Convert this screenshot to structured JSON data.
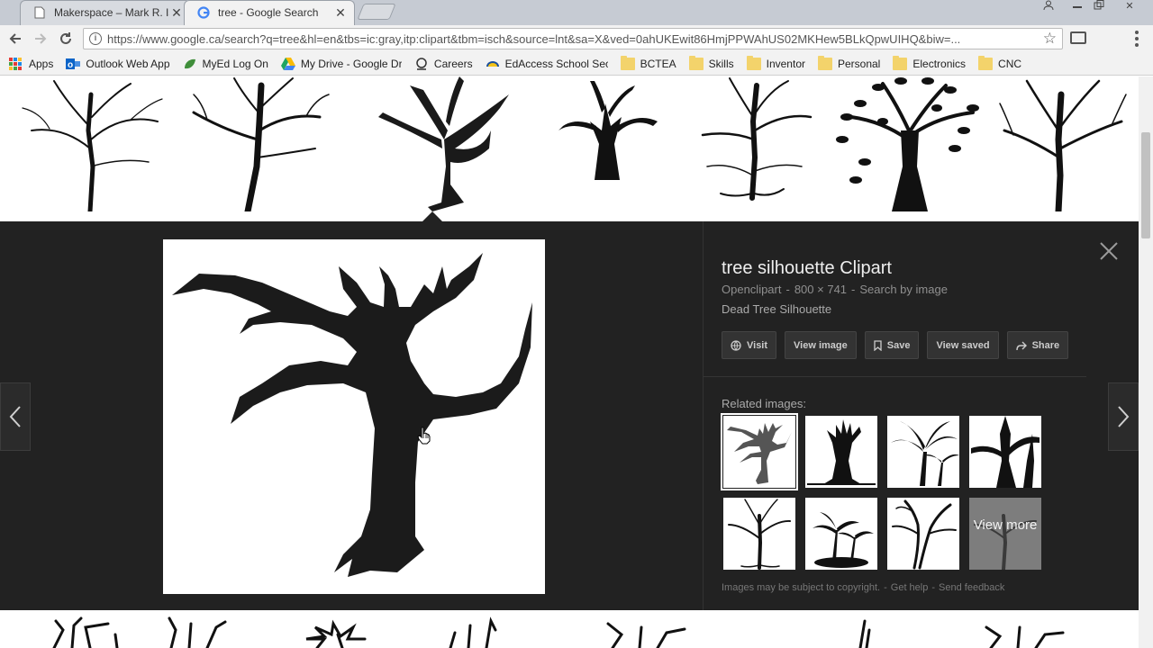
{
  "browser": {
    "tabs": [
      {
        "title": "Makerspace – Mark R. Isf",
        "active": false
      },
      {
        "title": "tree - Google Search",
        "active": true
      }
    ],
    "url": "https://www.google.ca/search?q=tree&hl=en&tbs=ic:gray,itp:clipart&tbm=isch&source=lnt&sa=X&ved=0ahUKEwit86HmjPPWAhUS02MKHew5BLkQpwUIHQ&biw=...",
    "bookmarks": [
      {
        "label": "Apps",
        "icon": "apps-grid-icon"
      },
      {
        "label": "Outlook Web App",
        "icon": "outlook-icon"
      },
      {
        "label": "MyEd Log On",
        "icon": "myed-icon"
      },
      {
        "label": "My Drive - Google Dr",
        "icon": "google-drive-icon"
      },
      {
        "label": "Careers",
        "icon": "careers-icon"
      },
      {
        "label": "EdAccess School Sec",
        "icon": "edaccess-icon"
      },
      {
        "label": "BCTEA",
        "icon": "folder-icon"
      },
      {
        "label": "Skills",
        "icon": "folder-icon"
      },
      {
        "label": "Inventor",
        "icon": "folder-icon"
      },
      {
        "label": "Personal",
        "icon": "folder-icon"
      },
      {
        "label": "Electronics",
        "icon": "folder-icon"
      },
      {
        "label": "CNC",
        "icon": "folder-icon"
      }
    ]
  },
  "viewer": {
    "title": "tree silhouette Clipart",
    "source": "Openclipart",
    "dimensions": "800 × 741",
    "search_by_image": "Search by image",
    "description": "Dead Tree Silhouette",
    "actions": {
      "visit": "Visit",
      "view_image": "View image",
      "save": "Save",
      "view_saved": "View saved",
      "share": "Share"
    },
    "related_label": "Related images:",
    "view_more": "View more",
    "footer": {
      "copyright": "Images may be subject to copyright.",
      "get_help": "Get help",
      "send_feedback": "Send feedback"
    }
  },
  "colors": {
    "panel_bg": "#222222",
    "tab_strip": "#c6cbd3",
    "toolbar": "#f2f2f2"
  }
}
